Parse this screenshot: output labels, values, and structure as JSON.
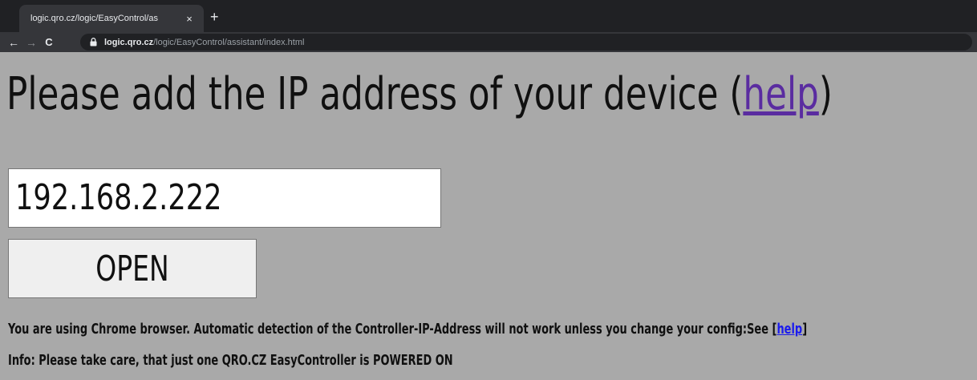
{
  "browser": {
    "tab_title": "logic.qro.cz/logic/EasyControl/as",
    "new_tab": "+",
    "close_glyph": "×",
    "back_glyph": "←",
    "forward_glyph": "→",
    "reload_glyph": "C",
    "url_host": "logic.qro.cz",
    "url_path": "/logic/EasyControl/assistant/index.html"
  },
  "page": {
    "headline_prefix": "Please add the IP address of your device (",
    "headline_link": "help",
    "headline_suffix": ")",
    "ip_value": "192.168.2.222",
    "open_label": "OPEN",
    "chrome_notice_prefix": "You are using Chrome browser. Automatic detection of the Controller-IP-Address will not work unless you change your config:See [",
    "chrome_notice_link": "help",
    "chrome_notice_suffix": "]",
    "info_text": "Info: Please take care, that just one QRO.CZ EasyController is POWERED ON"
  },
  "colors": {
    "page_background": "#a9a9a9",
    "link_visited": "#5a2ca0",
    "link": "#1a1aee"
  }
}
